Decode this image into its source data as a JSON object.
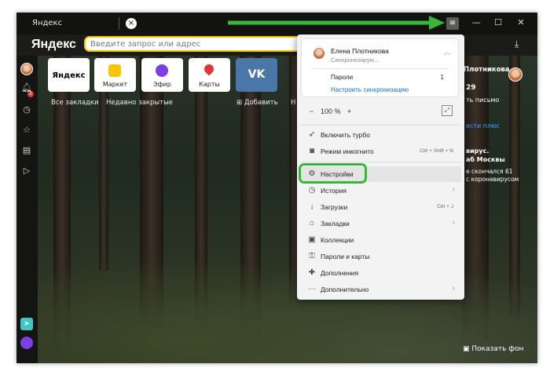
{
  "tab": {
    "title": "Яндекс",
    "close": "×"
  },
  "window": {
    "menu": "≡",
    "minimize": "—",
    "maximize": "☐",
    "close": "✕"
  },
  "logo": "Яндекс",
  "search": {
    "placeholder": "Введите запрос или адрес"
  },
  "download_icon": "download-icon",
  "sidebar": {
    "badge": "2"
  },
  "tiles": [
    {
      "label": "Яндекс",
      "color": "#ffffff"
    },
    {
      "label": "Маркет",
      "color": "#f6c600"
    },
    {
      "label": "Эфир",
      "color": "#7b3fe4"
    },
    {
      "label": "Карты",
      "color": "#e23636"
    },
    {
      "label": "VK",
      "color": "#4a76a8"
    }
  ],
  "bookmarks": {
    "all": "Все закладки",
    "recent": "Недавно закрытые",
    "add": "Добавить",
    "cut": "Н"
  },
  "right_panel": {
    "name": "Плотникова",
    "num": "29",
    "letter": "ть письмо",
    "plus": "ести плюс",
    "virus1": "вирус.",
    "virus2": "аб Москвы",
    "died": "е скончался 61",
    "corona": "с коронавирусом",
    "show_bg": "Показать фон"
  },
  "menu": {
    "account": {
      "name": "Елена Плотникова",
      "status": "Синхронизирую...",
      "passwords_label": "Пароли",
      "passwords_count": "1",
      "sync_link": "Настроить синхронизацию"
    },
    "zoom": {
      "minus": "−",
      "value": "100 %",
      "plus": "+"
    },
    "items": [
      {
        "label": "Включить турбо",
        "shortcut": "",
        "arrow": ""
      },
      {
        "label": "Режим инкогнито",
        "shortcut": "Ctrl + Shift + N",
        "arrow": ""
      },
      {
        "label": "Настройки",
        "shortcut": "",
        "arrow": ""
      },
      {
        "label": "История",
        "shortcut": "",
        "arrow": "›"
      },
      {
        "label": "Загрузки",
        "shortcut": "Ctrl + J",
        "arrow": ""
      },
      {
        "label": "Закладки",
        "shortcut": "",
        "arrow": "›"
      },
      {
        "label": "Коллекции",
        "shortcut": "",
        "arrow": ""
      },
      {
        "label": "Пароли и карты",
        "shortcut": "",
        "arrow": ""
      },
      {
        "label": "Дополнения",
        "shortcut": "",
        "arrow": ""
      },
      {
        "label": "Дополнительно",
        "shortcut": "",
        "arrow": "›"
      }
    ]
  },
  "colors": {
    "highlight": "#3bb43b",
    "link": "#1a6ed8",
    "search_border": "#f6c600"
  }
}
